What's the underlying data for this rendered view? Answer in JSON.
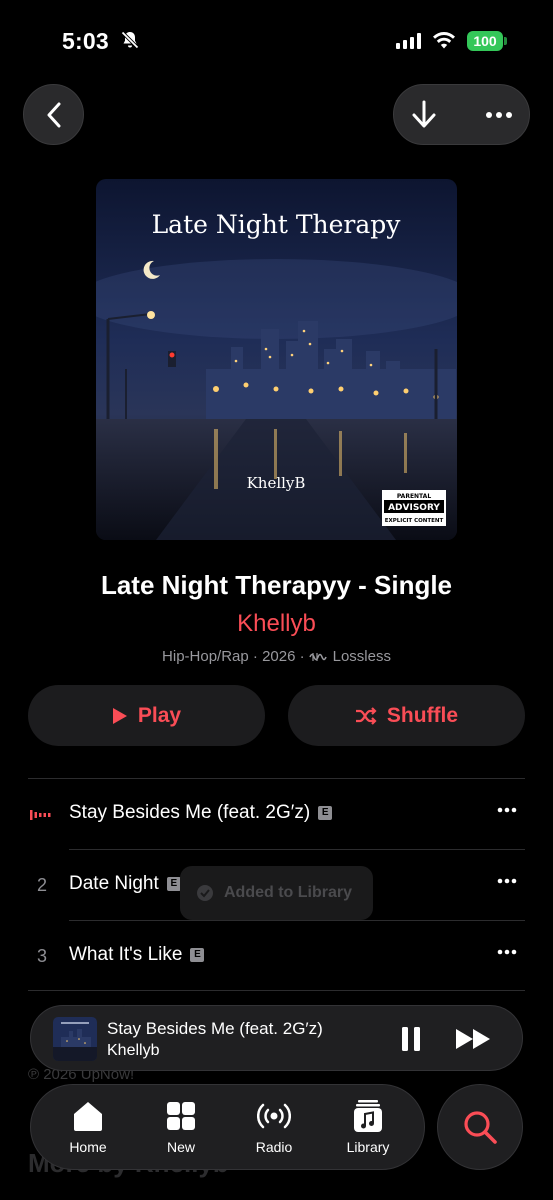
{
  "status_bar": {
    "time": "5:03",
    "battery": "100"
  },
  "album": {
    "artwork_title": "Late Night Therapy",
    "artwork_artist": "KhellyB",
    "advisory_top": "PARENTAL",
    "advisory_mid": "ADVISORY",
    "advisory_bottom": "EXPLICIT CONTENT",
    "title": "Late Night Therapyy - Single",
    "artist": "Khellyb",
    "genre_year": "Hip-Hop/Rap · 2026 ·",
    "quality": "Lossless"
  },
  "actions": {
    "play_label": "Play",
    "shuffle_label": "Shuffle"
  },
  "tracks": [
    {
      "number": "",
      "title": "Stay Besides Me (feat. 2G′z)",
      "explicit": "E",
      "playing": true
    },
    {
      "number": "2",
      "title": "Date Night",
      "explicit": "E",
      "playing": false
    },
    {
      "number": "3",
      "title": "What It's Like",
      "explicit": "E",
      "playing": false
    }
  ],
  "toast": {
    "text": "Added to Library"
  },
  "background": {
    "copyright": "℗ 2026 UpNow!",
    "more_by": "More by Khellyb"
  },
  "mini_player": {
    "title": "Stay Besides Me (feat. 2G′z)",
    "artist": "Khellyb"
  },
  "tabs": [
    {
      "label": "Home",
      "icon": "home-icon"
    },
    {
      "label": "New",
      "icon": "grid-icon"
    },
    {
      "label": "Radio",
      "icon": "radio-icon"
    },
    {
      "label": "Library",
      "icon": "library-icon"
    }
  ],
  "colors": {
    "accent": "#fa4d56",
    "battery": "#34c759",
    "surface": "#1c1c1e"
  }
}
